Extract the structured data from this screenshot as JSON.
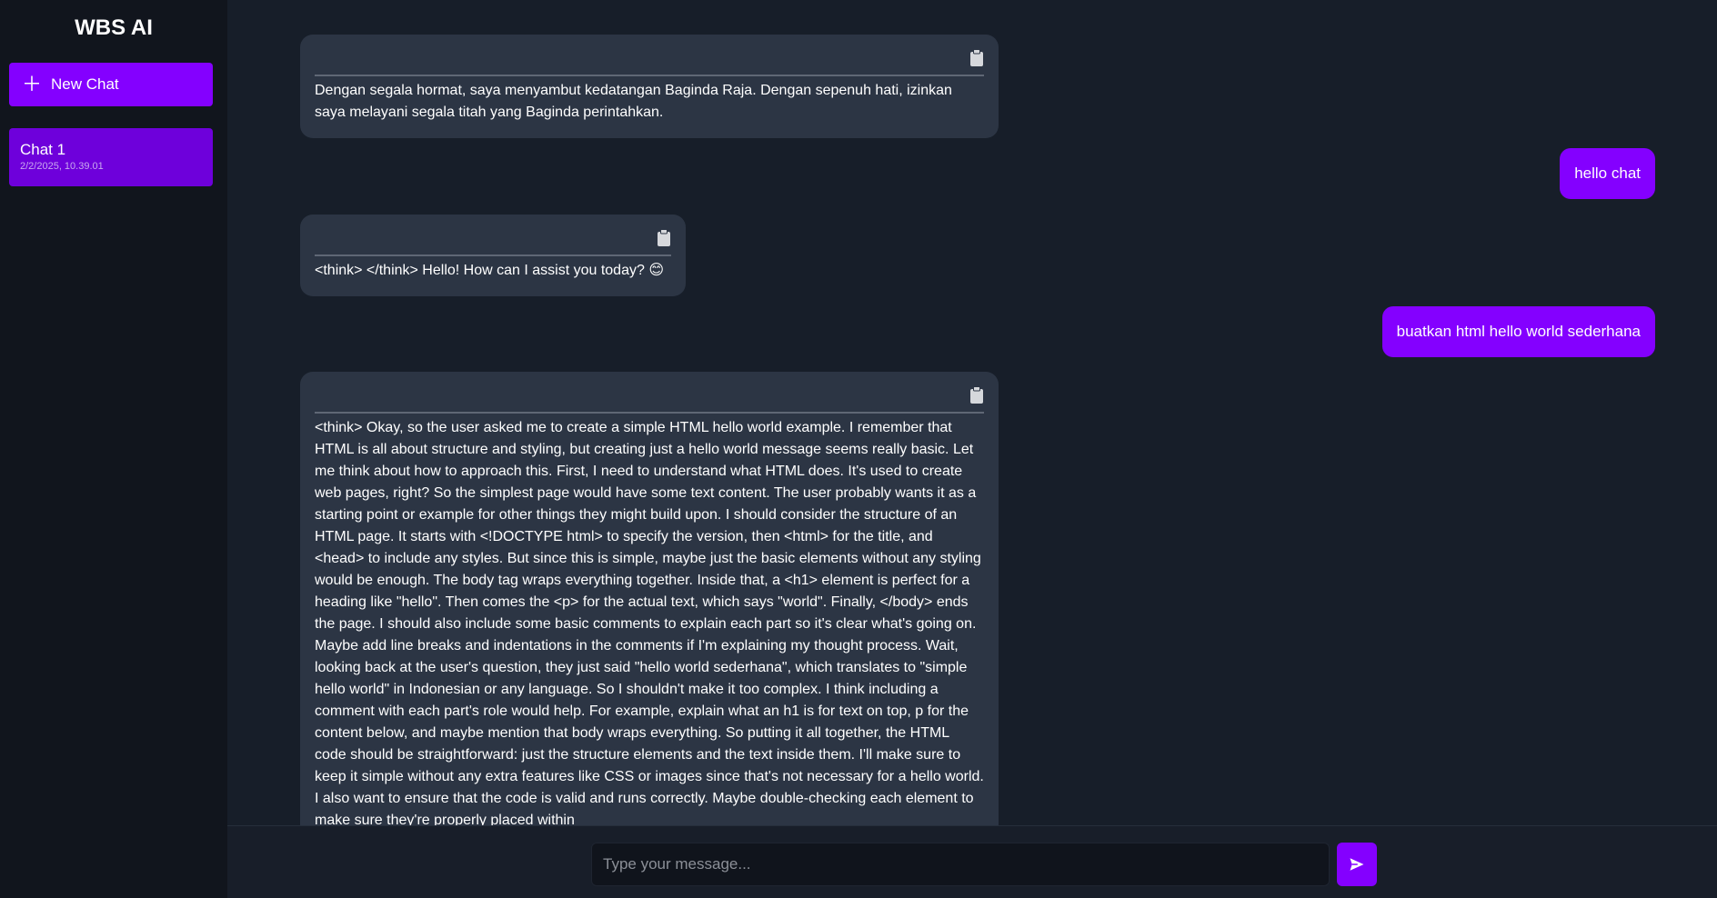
{
  "app": {
    "title": "WBS AI"
  },
  "sidebar": {
    "new_chat_label": "New Chat",
    "chats": [
      {
        "title": "Chat 1",
        "timestamp": "2/2/2025, 10.39.01"
      }
    ]
  },
  "messages": [
    {
      "role": "assistant",
      "text": "Dengan segala hormat, saya menyambut kedatangan Baginda Raja. Dengan sepenuh hati, izinkan saya melayani segala titah yang Baginda perintahkan."
    },
    {
      "role": "user",
      "text": "hello chat"
    },
    {
      "role": "assistant",
      "text": "<think> </think> Hello! How can I assist you today? 😊"
    },
    {
      "role": "user",
      "text": "buatkan html hello world sederhana"
    },
    {
      "role": "assistant",
      "text": "<think> Okay, so the user asked me to create a simple HTML hello world example. I remember that HTML is all about structure and styling, but creating just a hello world message seems really basic. Let me think about how to approach this. First, I need to understand what HTML does. It's used to create web pages, right? So the simplest page would have some text content. The user probably wants it as a starting point or example for other things they might build upon. I should consider the structure of an HTML page. It starts with <!DOCTYPE html> to specify the version, then <html> for the title, and <head> to include any styles. But since this is simple, maybe just the basic elements without any styling would be enough. The body tag wraps everything together. Inside that, a <h1> element is perfect for a heading like \"hello\". Then comes the <p> for the actual text, which says \"world\". Finally, </body> ends the page. I should also include some basic comments to explain each part so it's clear what's going on. Maybe add line breaks and indentations in the comments if I'm explaining my thought process. Wait, looking back at the user's question, they just said \"hello world sederhana\", which translates to \"simple hello world\" in Indonesian or any language. So I shouldn't make it too complex. I think including a comment with each part's role would help. For example, explain what an h1 is for text on top, p for the content below, and maybe mention that body wraps everything. So putting it all together, the HTML code should be straightforward: just the structure elements and the text inside them. I'll make sure to keep it simple without any extra features like CSS or images since that's not necessary for a hello world. I also want to ensure that the code is valid and runs correctly. Maybe double-checking each element to make sure they're properly placed within"
    }
  ],
  "composer": {
    "placeholder": "Type your message..."
  },
  "icons": {
    "copy": "clipboard-icon",
    "send": "send-icon",
    "new": "plus-icon"
  },
  "colors": {
    "accent": "#8400ff",
    "chat_item": "#6e00db",
    "bubble": "#2c3544",
    "background": "#171e29",
    "sidebar": "#11151d"
  }
}
